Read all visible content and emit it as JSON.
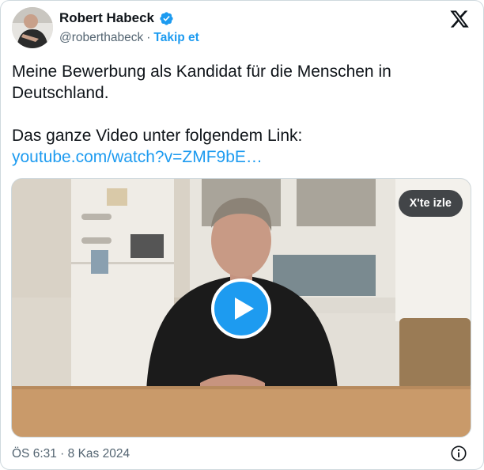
{
  "author": {
    "name": "Robert Habeck",
    "handle": "@roberthabeck",
    "separator": "·",
    "follow_label": "Takip et",
    "verified": true
  },
  "post": {
    "line1": "Meine Bewerbung als Kandidat für die Menschen in Deutschland.",
    "line2": "Das ganze Video unter folgendem Link:",
    "link": "youtube.com/watch?v=ZMF9bE…"
  },
  "video": {
    "watch_label": "X'te izle",
    "play_icon": "play-icon"
  },
  "footer": {
    "timestamp": "ÖS 6:31 · 8 Kas 2024"
  },
  "icons": {
    "verified": "verified-badge-icon",
    "brand": "x-logo-icon",
    "info": "info-icon"
  },
  "colors": {
    "accent": "#1d9bf0",
    "text": "#0f1419",
    "muted": "#536471",
    "border": "#cfd9de"
  }
}
